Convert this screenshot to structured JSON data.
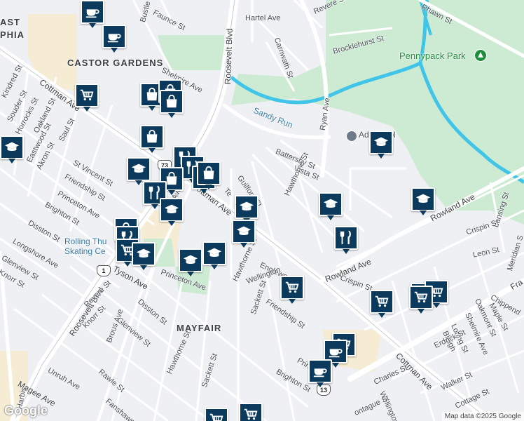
{
  "labels": {
    "neighborhood_castor": "CASTOR GARDENS",
    "neighborhood_mayfair": "MAYFAIR",
    "neighborhood_philly": "PHIA",
    "neighborhood_east": "AST",
    "park": "Pennypack Park",
    "creek": "Sandy Run",
    "school": "Ad      school",
    "rink": "Rolling Thu",
    "rink2": "Skating Ce",
    "roosevelt_top": "Roosevelt Blvd",
    "roosevelt_bottom": "Roosevelt Blvd",
    "cottman_left": "Cottman Ave",
    "cottman_mid": "Cottman Ave",
    "cottman_right": "Cottman Ave",
    "rowland_1": "Rowland Ave",
    "rowland_2": "Rowland Ave",
    "ryan": "Ryan Ave",
    "rhawn": "Rhawn St",
    "hartel": "Hartel Ave",
    "revere_top": "Revere St",
    "brocklehurst": "Brocklehurst St",
    "carnwath": "Carnwath St",
    "faunce": "Faunce St",
    "bustleton": "Bustle",
    "shelmire": "Shelmire Ave",
    "kindred": "Kindred St",
    "souder": "Souder St",
    "horrocks": "Horrocks St",
    "oakland": "Oakland St",
    "eastwood": "Eastwood St",
    "saul": "Saul St",
    "akron": "Akron St",
    "st_vincent": "St Vincent St",
    "friendship_left": "Friendship St",
    "princeton_left": "Princeton Ave",
    "brighton_left": "Brighton St",
    "disston_left": "Disston St",
    "longshore": "Longshore Ave",
    "glenview_left": "Glenview St",
    "knorr_left": "Knorr St",
    "tyson": "Tyson Ave",
    "brous": "Brous Ave",
    "brous2": "Brous Ave",
    "battersby": "Battersby St",
    "vista": "Vista St",
    "guilford": "Guilford St",
    "hawthorne": "Hawthorne St",
    "hawthorne2": "Hawthorne St",
    "hawthorne3": "Hawthorne St",
    "englewood": "Englewoo",
    "wellington": "Wellington",
    "sackett": "Sackett St",
    "sackett2": "Sackett St",
    "friendship_mid": "Friendship St",
    "princeton_mid": "Princeton Ave",
    "princeton_bot": "Princeto",
    "brighton_bot": "Brighton St",
    "disston_mid": "Disston St",
    "revere_mid": "Revere St",
    "knorr_mid": "Knorr St",
    "glenview_mid": "Glenview St",
    "rawle": "Rawle St",
    "unruh": "Unruh Ave",
    "magee": "Magee Ave",
    "fanshawe": "Fanshawe St",
    "harbis": "Harbis",
    "crispin_1": "Crispin St",
    "crispin_2": "Crispin St",
    "leon": "Leon St",
    "lansing": "Lansing St",
    "meridian": "Meridian S",
    "chippendale": "Chippend",
    "maple": "Maple St",
    "oakmont": "Oakmont St",
    "shelmire_right": "Shelmire Ave",
    "loring": "Loring St",
    "bleigh": "Bleigh",
    "erdrick": "Erdrick St",
    "walker": "Walker St",
    "cottage": "Cottage St",
    "charles": "Charles St",
    "wellington2": "Wellington St",
    "montague": "ontague St",
    "frankford": "Fra",
    "teesdale": "Te",
    "route_73": "73",
    "route_1": "1",
    "route_13": "13"
  },
  "pins": [
    {
      "type": "cafe",
      "name": "cafe"
    },
    {
      "type": "cafe",
      "name": "cafe"
    },
    {
      "type": "grocery",
      "name": "grocery"
    },
    {
      "type": "school",
      "name": "school"
    },
    {
      "type": "shopping",
      "name": "shopping"
    },
    {
      "type": "shopping",
      "name": "shopping"
    },
    {
      "type": "shopping",
      "name": "shopping"
    },
    {
      "type": "shopping",
      "name": "shopping"
    },
    {
      "type": "restaurant",
      "name": "restaurant"
    },
    {
      "type": "restaurant",
      "name": "restaurant"
    },
    {
      "type": "school",
      "name": "school"
    },
    {
      "type": "shopping",
      "name": "shopping"
    },
    {
      "type": "shopping",
      "name": "shopping"
    },
    {
      "type": "restaurant",
      "name": "restaurant"
    },
    {
      "type": "school",
      "name": "school"
    },
    {
      "type": "school",
      "name": "school"
    },
    {
      "type": "school",
      "name": "school"
    },
    {
      "type": "school",
      "name": "school"
    },
    {
      "type": "school",
      "name": "school"
    },
    {
      "type": "school",
      "name": "school"
    },
    {
      "type": "restaurant",
      "name": "restaurant"
    },
    {
      "type": "grocery",
      "name": "grocery"
    },
    {
      "type": "grocery",
      "name": "grocery"
    },
    {
      "type": "shopping",
      "name": "shopping"
    },
    {
      "type": "restaurant",
      "name": "restaurant"
    },
    {
      "type": "school",
      "name": "school"
    },
    {
      "type": "school",
      "name": "school"
    },
    {
      "type": "grocery",
      "name": "grocery"
    },
    {
      "type": "grocery",
      "name": "grocery"
    },
    {
      "type": "grocery",
      "name": "grocery"
    },
    {
      "type": "grocery",
      "name": "grocery"
    },
    {
      "type": "cafe",
      "name": "cafe"
    },
    {
      "type": "cafe",
      "name": "cafe"
    },
    {
      "type": "grocery",
      "name": "grocery"
    },
    {
      "type": "school",
      "name": "school"
    },
    {
      "type": "grocery",
      "name": "grocery"
    },
    {
      "type": "grocery",
      "name": "grocery"
    },
    {
      "type": "shopping",
      "name": "shopping"
    }
  ],
  "footer": {
    "google": "Google",
    "attribution": "Map data ©2025 Google"
  },
  "colors": {
    "pin": "#0b3a5c",
    "park": "#cdebd3",
    "water": "#40c4e8",
    "major_road": "#ffffff",
    "background": "#eef0f3",
    "commercial": "#f5ecd3"
  }
}
